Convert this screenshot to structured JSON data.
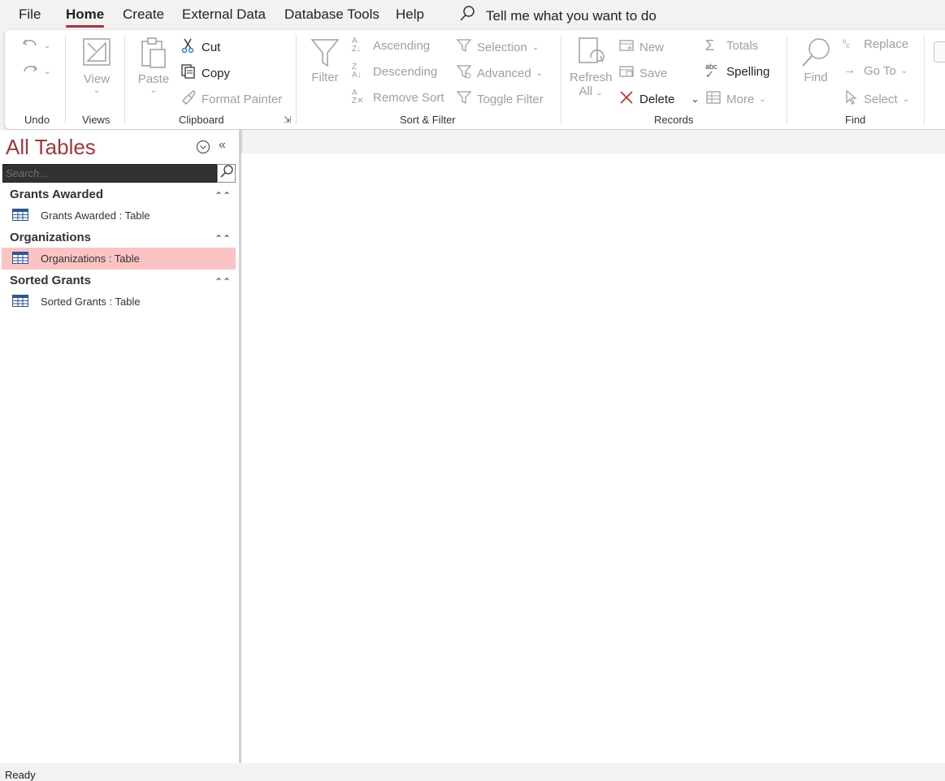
{
  "menu": {
    "tabs": [
      "File",
      "Home",
      "Create",
      "External Data",
      "Database Tools",
      "Help"
    ],
    "active": "Home",
    "tell_me": "Tell me what you want to do"
  },
  "ribbon": {
    "undo": {
      "label": "Undo"
    },
    "views": {
      "label": "Views",
      "view": "View"
    },
    "clipboard": {
      "label": "Clipboard",
      "paste": "Paste",
      "cut": "Cut",
      "copy": "Copy",
      "format_painter": "Format Painter"
    },
    "sort_filter": {
      "label": "Sort & Filter",
      "filter": "Filter",
      "ascending": "Ascending",
      "descending": "Descending",
      "remove_sort": "Remove Sort",
      "selection": "Selection",
      "advanced": "Advanced",
      "toggle_filter": "Toggle Filter"
    },
    "records": {
      "label": "Records",
      "refresh": "Refresh",
      "refresh_all": "All",
      "new": "New",
      "save": "Save",
      "delete": "Delete",
      "totals": "Totals",
      "spelling": "Spelling",
      "spelling_abc": "abc",
      "more": "More"
    },
    "find": {
      "label": "Find",
      "find": "Find",
      "replace": "Replace",
      "goto": "Go To",
      "select": "Select"
    }
  },
  "nav": {
    "title": "All Tables",
    "search_placeholder": "Search...",
    "groups": [
      {
        "name": "Grants Awarded",
        "item": "Grants Awarded : Table"
      },
      {
        "name": "Organizations",
        "item": "Organizations : Table"
      },
      {
        "name": "Sorted Grants",
        "item": "Sorted Grants : Table"
      }
    ]
  },
  "status": {
    "text": "Ready"
  },
  "colors": {
    "accent": "#a4373a",
    "selected_row": "#fcc3c5",
    "search_bg": "#323130"
  }
}
